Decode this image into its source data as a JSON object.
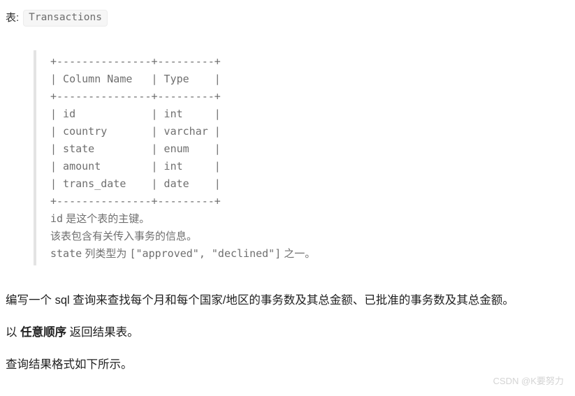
{
  "header": {
    "label": "表:",
    "table_name": "Transactions"
  },
  "schema": {
    "ascii_table": "+---------------+---------+\n| Column Name   | Type    |\n+---------------+---------+\n| id            | int     |\n| country       | varchar |\n| state         | enum    |\n| amount        | int     |\n| trans_date    | date    |\n+---------------+---------+",
    "columns": [
      {
        "name": "id",
        "type": "int"
      },
      {
        "name": "country",
        "type": "varchar"
      },
      {
        "name": "state",
        "type": "enum"
      },
      {
        "name": "amount",
        "type": "int"
      },
      {
        "name": "trans_date",
        "type": "date"
      }
    ],
    "column_headers": [
      "Column Name",
      "Type"
    ],
    "notes": [
      {
        "code": "id",
        "text": " 是这个表的主键。"
      },
      {
        "code": "",
        "text": "该表包含有关传入事务的信息。"
      },
      {
        "code": "state",
        "text": " 列类型为 ",
        "code2": "[\"approved\", \"declined\"]",
        "text2": " 之一。"
      }
    ]
  },
  "body": {
    "paragraph_1": "编写一个 sql 查询来查找每个月和每个国家/地区的事务数及其总金额、已批准的事务数及其总金额。",
    "paragraph_2_prefix": "以 ",
    "paragraph_2_bold": "任意顺序",
    "paragraph_2_suffix": " 返回结果表。",
    "paragraph_3": "查询结果格式如下所示。"
  },
  "watermark": {
    "text": "CSDN @K要努力"
  },
  "colors": {
    "page_background": "#ffffff",
    "body_text": "#1f1f1f",
    "muted_text": "#6f6f6f",
    "blockquote_border": "#e3e3e3",
    "code_badge_background": "#f6f6f6",
    "watermark_text": "#d4d4d4"
  }
}
